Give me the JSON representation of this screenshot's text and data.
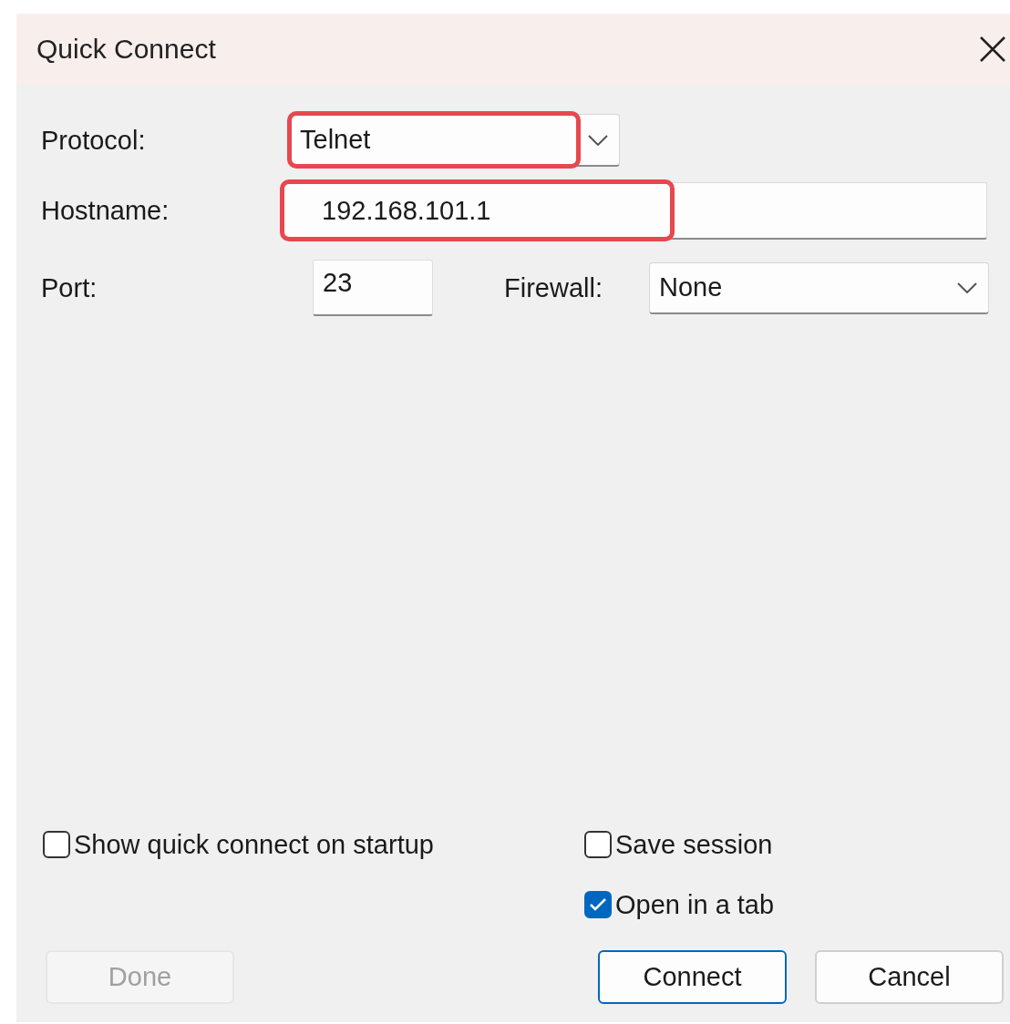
{
  "window": {
    "title": "Quick Connect"
  },
  "protocol": {
    "label": "Protocol:",
    "value": "Telnet",
    "highlighted": true
  },
  "hostname": {
    "label": "Hostname:",
    "value": "192.168.101.1",
    "highlighted": true
  },
  "port": {
    "label": "Port:",
    "value": "23"
  },
  "firewall": {
    "label": "Firewall:",
    "value": "None"
  },
  "options": [
    {
      "label": "Show quick connect on startup",
      "checked": false
    },
    {
      "label": "Save session",
      "checked": false
    },
    {
      "label": "Open in a tab",
      "checked": true
    }
  ],
  "buttons": [
    {
      "label": "Done",
      "disabled": true,
      "default": false
    },
    {
      "label": "Connect",
      "disabled": false,
      "default": true
    },
    {
      "label": "Cancel",
      "disabled": false,
      "default": false
    }
  ]
}
